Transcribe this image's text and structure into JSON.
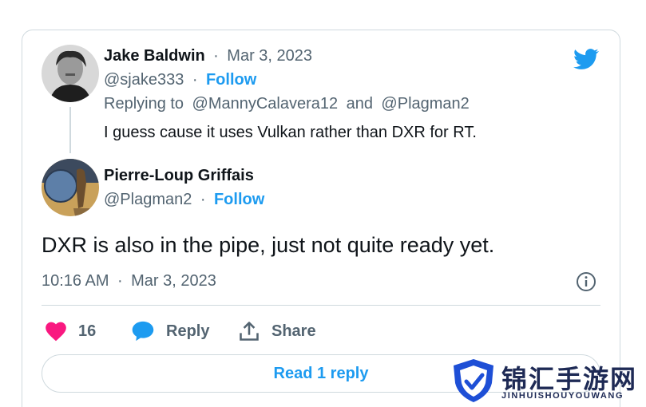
{
  "reply_tweet": {
    "author_name": "Jake Baldwin",
    "date": "Mar 3, 2023",
    "handle": "@sjake333",
    "follow_label": "Follow",
    "replying_prefix": "Replying to",
    "replying_to_1": "@MannyCalavera12",
    "replying_and": "and",
    "replying_to_2": "@Plagman2",
    "text": "I guess cause it uses Vulkan rather than DXR for RT."
  },
  "main_tweet": {
    "author_name": "Pierre-Loup Griffais",
    "handle": "@Plagman2",
    "follow_label": "Follow",
    "text": "DXR is also in the pipe, just not quite ready yet.",
    "time": "10:16 AM",
    "date": "Mar 3, 2023"
  },
  "separator": "·",
  "actions": {
    "like_count": "16",
    "reply_label": "Reply",
    "share_label": "Share",
    "read_replies_label": "Read 1 reply"
  },
  "watermark": {
    "cn_text": "锦汇手游网",
    "en_text": "JINHUISHOUYOUWANG"
  },
  "colors": {
    "twitter_blue": "#1d9bf0",
    "like_pink": "#f91880",
    "muted_gray": "#536471",
    "border": "#cfd9de"
  },
  "icons": [
    "twitter-bird-icon",
    "info-icon",
    "heart-icon",
    "speech-bubble-icon",
    "share-icon",
    "shield-logo-icon"
  ]
}
